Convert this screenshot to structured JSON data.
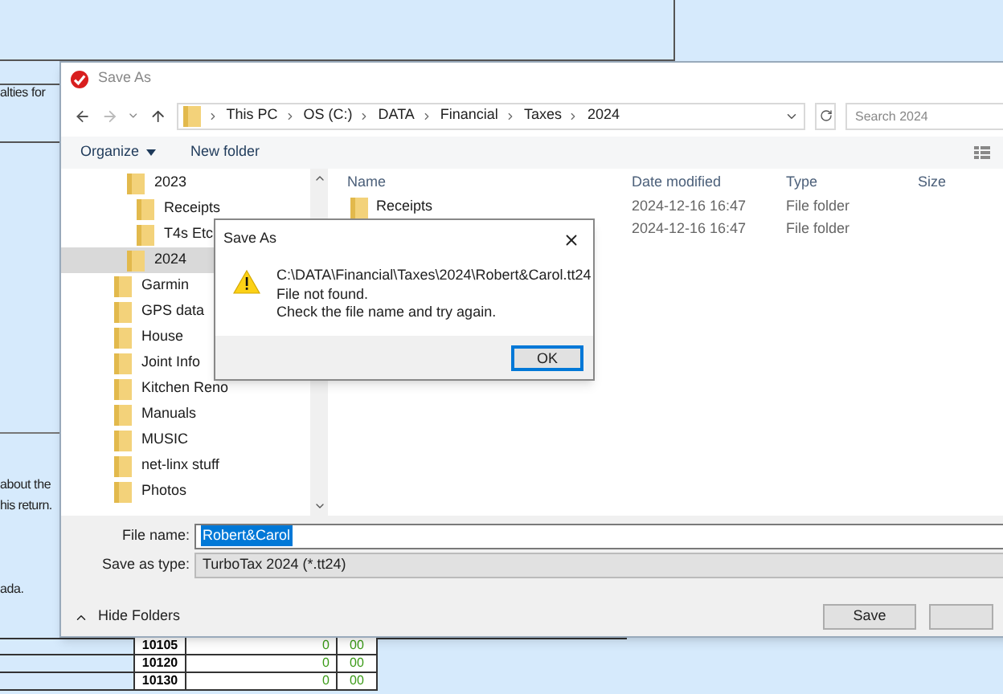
{
  "background": {
    "texts": [
      "alties for",
      "about the",
      "his return.",
      "ada."
    ],
    "table_rows": [
      {
        "code": "10105",
        "amount": "0",
        "cents": "00"
      },
      {
        "code": "10120",
        "amount": "0",
        "cents": "00"
      },
      {
        "code": "10130",
        "amount": "0",
        "cents": "00"
      }
    ]
  },
  "save_dialog": {
    "title": "Save As",
    "breadcrumbs": [
      "This PC",
      "OS (C:)",
      "DATA",
      "Financial",
      "Taxes",
      "2024"
    ],
    "search": {
      "placeholder": "Search 2024"
    },
    "toolbar": {
      "organize": "Organize",
      "new_folder": "New folder"
    },
    "year_folders": [
      {
        "name": "2023",
        "selected": false,
        "children": [
          {
            "name": "Receipts",
            "selected": false
          },
          {
            "name": "T4s Etc",
            "selected": false
          }
        ]
      },
      {
        "name": "2024",
        "selected": true
      }
    ],
    "folders": [
      {
        "name": "Garmin",
        "selected": false
      },
      {
        "name": "GPS data",
        "selected": false
      },
      {
        "name": "House",
        "selected": false
      },
      {
        "name": "Joint Info",
        "selected": false
      },
      {
        "name": "Kitchen Reno",
        "selected": false
      },
      {
        "name": "Manuals",
        "selected": false
      },
      {
        "name": "MUSIC",
        "selected": false
      },
      {
        "name": "net-linx stuff",
        "selected": false
      },
      {
        "name": "Photos",
        "selected": false
      }
    ],
    "columns": [
      "Name",
      "Date modified",
      "Type",
      "Size"
    ],
    "files": [
      {
        "name": "Receipts",
        "date": "2024-12-16 16:47",
        "type": "File folder"
      },
      {
        "date": "2024-12-16 16:47",
        "type": "File folder"
      }
    ],
    "file_name": {
      "label": "File name:",
      "value": "Robert&Carol"
    },
    "save_type": {
      "label": "Save as type:",
      "value": "TurboTax 2024 (*.tt24)"
    },
    "hide_folders": "Hide Folders",
    "save_button": "Save"
  },
  "message_box": {
    "title": "Save As",
    "lines": [
      "C:\\DATA\\Financial\\Taxes\\2024\\Robert&Carol.tt24",
      "File not found.",
      "Check the file name and try again."
    ],
    "button": "OK"
  }
}
